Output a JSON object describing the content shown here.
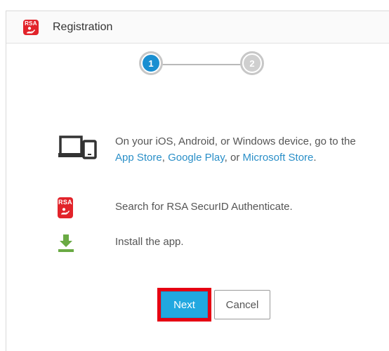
{
  "header": {
    "logo_text": "RSA",
    "title": "Registration"
  },
  "stepper": {
    "steps": [
      {
        "number": "1",
        "state": "active"
      },
      {
        "number": "2",
        "state": "inactive"
      }
    ]
  },
  "instructions": [
    {
      "icon": "devices-icon",
      "parts": {
        "text1": "On your iOS, Android, or Windows device, go to the ",
        "link1": "App Store",
        "text2": ", ",
        "link2": "Google Play",
        "text3": ", or ",
        "link3": "Microsoft Store",
        "text4": "."
      }
    },
    {
      "icon": "rsa-app-icon",
      "icon_text": "RSA",
      "text": "Search for RSA SecurID Authenticate."
    },
    {
      "icon": "download-icon",
      "text": "Install the app."
    }
  ],
  "buttons": {
    "next": "Next",
    "cancel": "Cancel"
  },
  "colors": {
    "rsa_red": "#e2232a",
    "step_active": "#1a8fd1",
    "link": "#2a8fc8",
    "primary_button": "#22a8e0",
    "highlight_border": "#e60012",
    "download_green": "#6aaa44"
  }
}
